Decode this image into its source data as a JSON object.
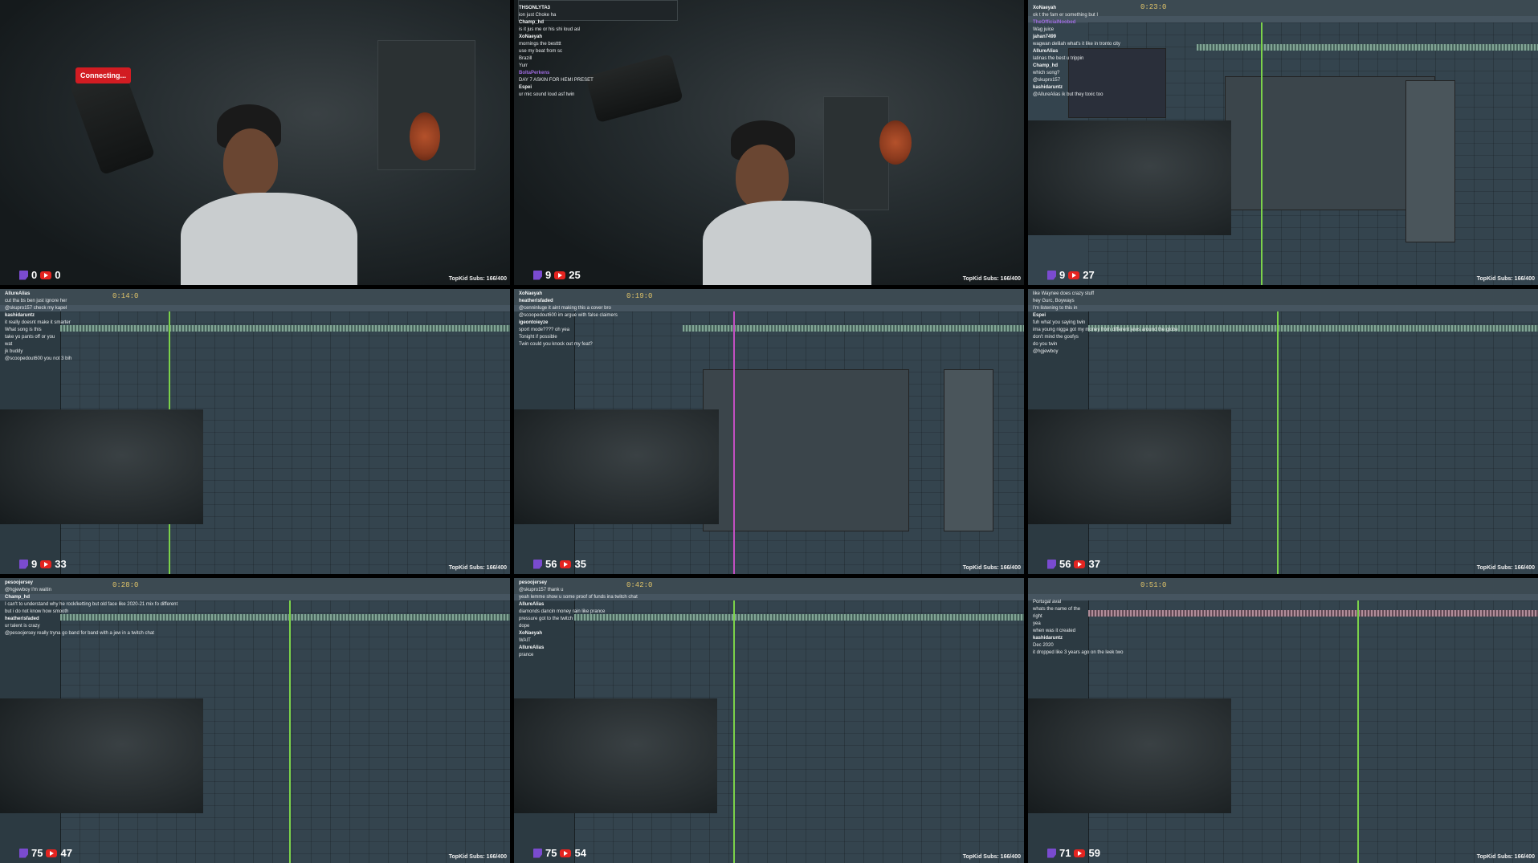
{
  "overlay": {
    "subs_text": "TopKid Subs: 166/400",
    "connecting": "Connecting..."
  },
  "panels": [
    {
      "id": 1,
      "twitch": "0",
      "youtube": "0",
      "chat": []
    },
    {
      "id": 2,
      "twitch": "9",
      "youtube": "25",
      "chat": [
        {
          "u": "THSONLYTA3",
          "m": "",
          "c": "w"
        },
        {
          "u": "",
          "m": "ion just Choke ha",
          "c": "w"
        },
        {
          "u": "Champ_hd",
          "m": "is it jus me or his shi loud asl",
          "c": "w"
        },
        {
          "u": "XoNaeyah",
          "m": "mornings the bestttt",
          "c": "w"
        },
        {
          "u": "",
          "m": "use my beat from sc",
          "c": "r"
        },
        {
          "u": "",
          "m": "Brazill",
          "c": "w"
        },
        {
          "u": "",
          "m": "Yurr",
          "c": "r"
        },
        {
          "u": "BoltaPerkens",
          "m": "DAY 7 ASKIN FOR HEMI PRESET",
          "c": "p"
        },
        {
          "u": "Espei",
          "m": "ur mic sound loud asf twin",
          "c": "w"
        }
      ]
    },
    {
      "id": 3,
      "twitch": "9",
      "youtube": "27",
      "timer": "0:23:0",
      "chat": [
        {
          "u": "XoNaeyah",
          "m": "ok t the fam er something but I",
          "c": "w"
        },
        {
          "u": "TheOfficialNoobed",
          "m": "Wag juice",
          "c": "p"
        },
        {
          "u": "jahan7499",
          "m": "wagwan delilah what's it like in tronto city",
          "c": "w"
        },
        {
          "u": "AllureAlias",
          "m": "latinas the best u trippin",
          "c": "w"
        },
        {
          "u": "Champ_hd",
          "m": "which song?",
          "c": "w"
        },
        {
          "u": "",
          "m": "@skupro157",
          "c": "w"
        },
        {
          "u": "kashidaruntz",
          "m": "@AllureAlias ik but they toxic too",
          "c": "w"
        }
      ]
    },
    {
      "id": 4,
      "twitch": "9",
      "youtube": "33",
      "timer": "0:14:0",
      "chat": [
        {
          "u": "AllureAlias",
          "m": "cut tha bs ben just ignore her",
          "c": "w"
        },
        {
          "u": "",
          "m": "@skupro157 check my kapel",
          "c": "w"
        },
        {
          "u": "kashidaruntz",
          "m": "it really doesnt make it smarter",
          "c": "w"
        },
        {
          "u": "",
          "m": "What song is this",
          "c": "r"
        },
        {
          "u": "",
          "m": "take yo pants off or you",
          "c": "w"
        },
        {
          "u": "",
          "m": "wat",
          "c": "r"
        },
        {
          "u": "",
          "m": "jk buddy",
          "c": "p"
        },
        {
          "u": "",
          "m": "@scoopedout600 you not 3 bih",
          "c": "r"
        }
      ]
    },
    {
      "id": 5,
      "twitch": "56",
      "youtube": "35",
      "timer": "0:19:0",
      "chat": [
        {
          "u": "XoNaeyah",
          "m": "",
          "c": "w"
        },
        {
          "u": "heatherisfaded",
          "m": "",
          "c": "w"
        },
        {
          "u": "",
          "m": "@cenninluge it aint making this a cover bro",
          "c": "w"
        },
        {
          "u": "",
          "m": "@scoopedout600 im argue with false claimers",
          "c": "w"
        },
        {
          "u": "igeontoieyze",
          "m": "sport mode???? oh yea",
          "c": "w"
        },
        {
          "u": "",
          "m": "Tonight if possible",
          "c": "r"
        },
        {
          "u": "",
          "m": "Twin could you knock out my feat?",
          "c": "r"
        }
      ]
    },
    {
      "id": 6,
      "twitch": "56",
      "youtube": "37",
      "chat": [
        {
          "u": "",
          "m": "like Waynee does crazy stuff",
          "c": "w"
        },
        {
          "u": "",
          "m": "hey Gurc, Boyways",
          "c": "w"
        },
        {
          "u": "",
          "m": "I'm listening to this in",
          "c": "w"
        },
        {
          "u": "Espei",
          "m": "fuh what you saying twin",
          "c": "w"
        },
        {
          "u": "",
          "m": "ima young nigga got my money from different jews around the globe",
          "c": "w"
        },
        {
          "u": "",
          "m": "don't mind the goofys",
          "c": "w"
        },
        {
          "u": "",
          "m": "do you twin",
          "c": "p"
        },
        {
          "u": "",
          "m": "@hgjewboy",
          "c": "r"
        }
      ]
    },
    {
      "id": 7,
      "twitch": "75",
      "youtube": "47",
      "timer": "0:28:0",
      "chat": [
        {
          "u": "pesoojersey",
          "m": "",
          "c": "w"
        },
        {
          "u": "",
          "m": "@hgjewboy I'm waitin",
          "c": "w"
        },
        {
          "u": "Champ_hd",
          "m": "I can't to understand why he rock/ketting but old face like 2020-21 mix fo different",
          "c": "w"
        },
        {
          "u": "",
          "m": "but i do not know how smooth",
          "c": "w"
        },
        {
          "u": "heatherisfaded",
          "m": "ur talent is crazy",
          "c": "w"
        },
        {
          "u": "",
          "m": "@pesoojersey really tryna go band for band with a jew in a twitch chat",
          "c": "w"
        }
      ]
    },
    {
      "id": 8,
      "twitch": "75",
      "youtube": "54",
      "timer": "0:42:0",
      "chat": [
        {
          "u": "pesoojersey",
          "m": "",
          "c": "w"
        },
        {
          "u": "",
          "m": "@skupro157 thank u",
          "c": "w"
        },
        {
          "u": "",
          "m": "yeah lemme show u some proof of funds ina twitch chat",
          "c": "w"
        },
        {
          "u": "AllureAlias",
          "m": "diamonds dancin money rain like prance",
          "c": "w"
        },
        {
          "u": "",
          "m": "pressure got to the twitch",
          "c": "w"
        },
        {
          "u": "",
          "m": "dope",
          "c": "r"
        },
        {
          "u": "XoNaeyah",
          "m": "WAIT",
          "c": "w"
        },
        {
          "u": "AllureAlias",
          "m": "prance",
          "c": "w"
        }
      ]
    },
    {
      "id": 9,
      "twitch": "71",
      "youtube": "59",
      "timer": "0:51:0",
      "chat": [
        {
          "u": "",
          "m": "Portugal aval",
          "c": "w"
        },
        {
          "u": "",
          "m": "whats the name of the",
          "c": "g"
        },
        {
          "u": "",
          "m": "right",
          "c": "w"
        },
        {
          "u": "",
          "m": "yea",
          "c": "g"
        },
        {
          "u": "",
          "m": "when was it created",
          "c": "g"
        },
        {
          "u": "kashidaruntz",
          "m": "Dec 2020",
          "c": "w"
        },
        {
          "u": "",
          "m": "it dropped like 3 years ago on the leek two",
          "c": "r"
        }
      ]
    }
  ]
}
